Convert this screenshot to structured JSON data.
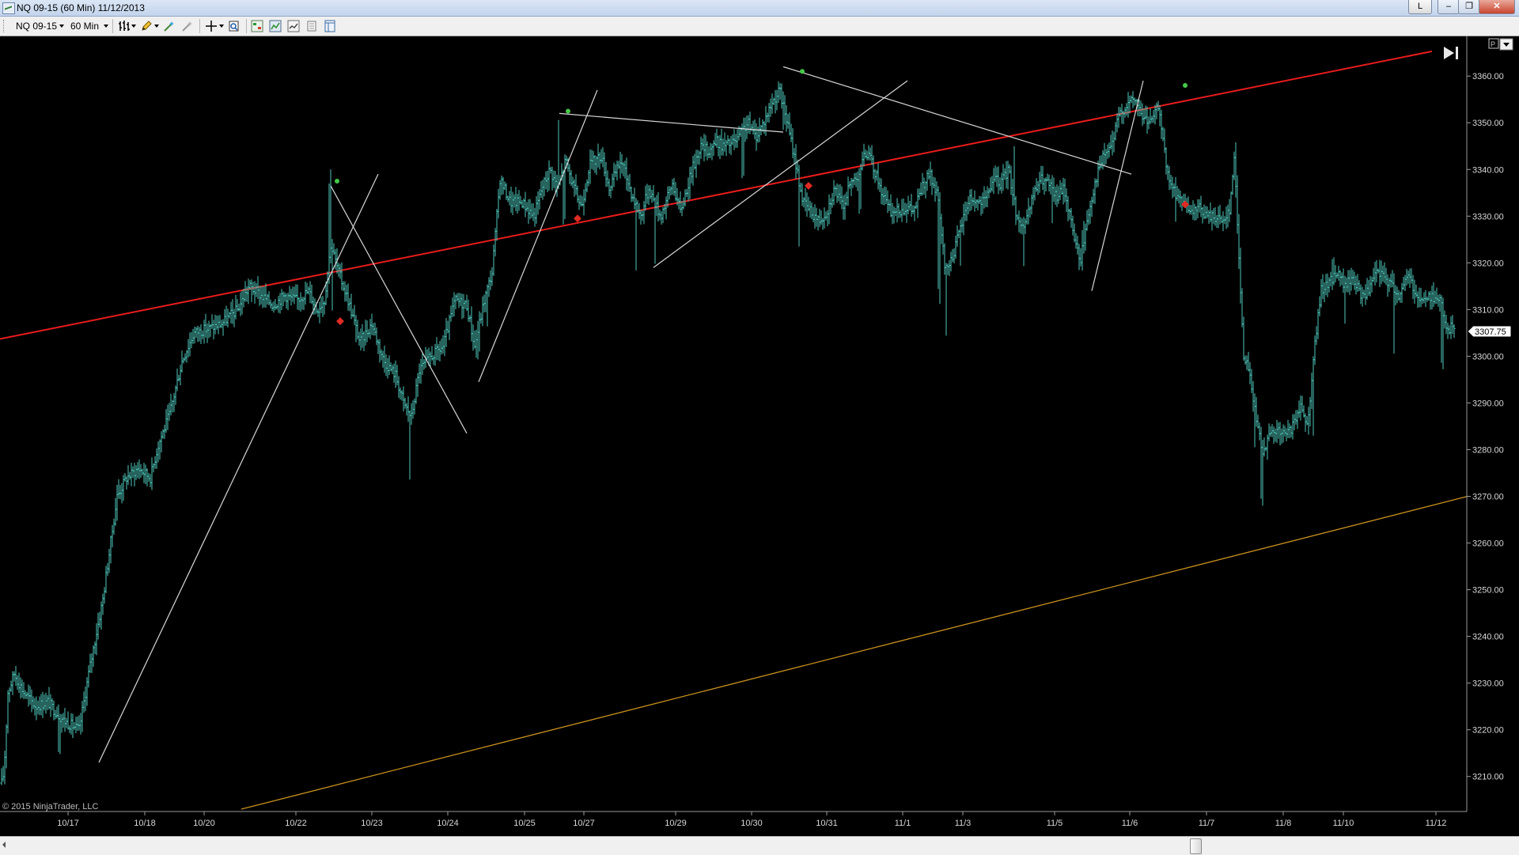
{
  "window": {
    "title": "NQ 09-15 (60 Min)  11/12/2013",
    "btn_l": "L",
    "btn_min": "–",
    "btn_max": "❐",
    "btn_close": "✕"
  },
  "toolbar": {
    "instrument": "NQ 09-15",
    "interval": "60 Min",
    "icons": [
      "bar-style-icon",
      "pencil-draw-icon",
      "magic-wand-icon",
      "wand-disabled-icon",
      "crosshair-icon",
      "zoom-icon",
      "chart-trader-icon",
      "strategies-icon",
      "indicators-icon",
      "properties-icon",
      "data-box-icon"
    ]
  },
  "chart": {
    "copyright": "© 2015 NinjaTrader, LLC",
    "price_marker": "3307.75",
    "y_ticks": [
      "3360.00",
      "3350.00",
      "3340.00",
      "3330.00",
      "3320.00",
      "3310.00",
      "3300.00",
      "3290.00",
      "3280.00",
      "3270.00",
      "3260.00",
      "3250.00",
      "3240.00",
      "3230.00",
      "3220.00",
      "3210.00"
    ],
    "x_ticks": [
      "10/17",
      "10/18",
      "10/20",
      "10/22",
      "10/23",
      "10/24",
      "10/25",
      "10/27",
      "10/29",
      "10/30",
      "10/31",
      "11/1",
      "11/3",
      "11/5",
      "11/6",
      "11/7",
      "11/8",
      "11/10",
      "11/12"
    ],
    "colors": {
      "background": "#000000",
      "bars": "#4fc9bd",
      "trendline_red": "#e81c1c",
      "trendline_gold": "#c8901e",
      "zigzag": "#d8d8d8",
      "dot_high": "#46c84a",
      "dot_low": "#e02a24"
    }
  },
  "chart_data": {
    "type": "ohlc",
    "instrument": "NQ 09-15",
    "interval": "60 Min",
    "ylim": [
      3202.5,
      3368.5
    ],
    "anchor_points": [
      [
        0,
        3207
      ],
      [
        5,
        3211
      ],
      [
        10,
        3228
      ],
      [
        18,
        3232
      ],
      [
        30,
        3228
      ],
      [
        45,
        3225
      ],
      [
        60,
        3226
      ],
      [
        80,
        3222
      ],
      [
        100,
        3220
      ],
      [
        112,
        3232
      ],
      [
        130,
        3248
      ],
      [
        148,
        3270
      ],
      [
        160,
        3274
      ],
      [
        175,
        3276
      ],
      [
        190,
        3274
      ],
      [
        200,
        3281
      ],
      [
        215,
        3288
      ],
      [
        230,
        3299
      ],
      [
        245,
        3305
      ],
      [
        265,
        3306
      ],
      [
        280,
        3307
      ],
      [
        300,
        3310
      ],
      [
        315,
        3315
      ],
      [
        330,
        3313
      ],
      [
        345,
        3311
      ],
      [
        360,
        3313
      ],
      [
        375,
        3312
      ],
      [
        390,
        3314
      ],
      [
        400,
        3310
      ],
      [
        410,
        3312
      ],
      [
        418,
        3324
      ],
      [
        428,
        3318
      ],
      [
        440,
        3312
      ],
      [
        455,
        3303
      ],
      [
        470,
        3307
      ],
      [
        485,
        3299
      ],
      [
        500,
        3296
      ],
      [
        510,
        3290
      ],
      [
        520,
        3287
      ],
      [
        530,
        3297
      ],
      [
        545,
        3300
      ],
      [
        560,
        3302
      ],
      [
        575,
        3312
      ],
      [
        590,
        3311
      ],
      [
        600,
        3302
      ],
      [
        612,
        3312
      ],
      [
        622,
        3318
      ],
      [
        632,
        3338
      ],
      [
        645,
        3333
      ],
      [
        660,
        3333
      ],
      [
        675,
        3330
      ],
      [
        685,
        3336
      ],
      [
        695,
        3340
      ],
      [
        705,
        3336
      ],
      [
        715,
        3342
      ],
      [
        725,
        3336
      ],
      [
        735,
        3332
      ],
      [
        745,
        3341
      ],
      [
        760,
        3343
      ],
      [
        770,
        3336
      ],
      [
        785,
        3342
      ],
      [
        800,
        3334
      ],
      [
        810,
        3330
      ],
      [
        820,
        3336
      ],
      [
        835,
        3330
      ],
      [
        850,
        3337
      ],
      [
        860,
        3331
      ],
      [
        875,
        3340
      ],
      [
        885,
        3345
      ],
      [
        895,
        3344
      ],
      [
        905,
        3346
      ],
      [
        915,
        3345
      ],
      [
        930,
        3346
      ],
      [
        945,
        3350
      ],
      [
        955,
        3347
      ],
      [
        965,
        3350
      ],
      [
        975,
        3354
      ],
      [
        985,
        3357
      ],
      [
        995,
        3350
      ],
      [
        1005,
        3342
      ],
      [
        1015,
        3333
      ],
      [
        1025,
        3331
      ],
      [
        1035,
        3329
      ],
      [
        1045,
        3331
      ],
      [
        1055,
        3336
      ],
      [
        1065,
        3332
      ],
      [
        1075,
        3337
      ],
      [
        1085,
        3339
      ],
      [
        1095,
        3344
      ],
      [
        1105,
        3340
      ],
      [
        1115,
        3335
      ],
      [
        1125,
        3331
      ],
      [
        1135,
        3331
      ],
      [
        1145,
        3332
      ],
      [
        1155,
        3331
      ],
      [
        1165,
        3336
      ],
      [
        1175,
        3339
      ],
      [
        1185,
        3334
      ],
      [
        1195,
        3318
      ],
      [
        1205,
        3322
      ],
      [
        1215,
        3328
      ],
      [
        1225,
        3334
      ],
      [
        1235,
        3333
      ],
      [
        1245,
        3333
      ],
      [
        1255,
        3338
      ],
      [
        1265,
        3337
      ],
      [
        1275,
        3340
      ],
      [
        1285,
        3330
      ],
      [
        1295,
        3327
      ],
      [
        1305,
        3334
      ],
      [
        1315,
        3338
      ],
      [
        1325,
        3337
      ],
      [
        1335,
        3334
      ],
      [
        1345,
        3336
      ],
      [
        1355,
        3328
      ],
      [
        1365,
        3320
      ],
      [
        1375,
        3330
      ],
      [
        1385,
        3338
      ],
      [
        1395,
        3343
      ],
      [
        1405,
        3345
      ],
      [
        1415,
        3352
      ],
      [
        1425,
        3354
      ],
      [
        1435,
        3355
      ],
      [
        1445,
        3351
      ],
      [
        1455,
        3350
      ],
      [
        1465,
        3354
      ],
      [
        1475,
        3339
      ],
      [
        1485,
        3335
      ],
      [
        1495,
        3333
      ],
      [
        1505,
        3330
      ],
      [
        1515,
        3332
      ],
      [
        1525,
        3330
      ],
      [
        1535,
        3330
      ],
      [
        1545,
        3329
      ],
      [
        1555,
        3332
      ],
      [
        1560,
        3343
      ],
      [
        1565,
        3325
      ],
      [
        1572,
        3300
      ],
      [
        1580,
        3296
      ],
      [
        1588,
        3286
      ],
      [
        1596,
        3280
      ],
      [
        1605,
        3283
      ],
      [
        1615,
        3284
      ],
      [
        1625,
        3283
      ],
      [
        1635,
        3285
      ],
      [
        1645,
        3290
      ],
      [
        1653,
        3285
      ],
      [
        1660,
        3300
      ],
      [
        1670,
        3314
      ],
      [
        1680,
        3316
      ],
      [
        1690,
        3318
      ],
      [
        1700,
        3315
      ],
      [
        1710,
        3317
      ],
      [
        1720,
        3313
      ],
      [
        1730,
        3314
      ],
      [
        1740,
        3318
      ],
      [
        1750,
        3317
      ],
      [
        1760,
        3315
      ],
      [
        1770,
        3313
      ],
      [
        1780,
        3318
      ],
      [
        1790,
        3313
      ],
      [
        1800,
        3312
      ],
      [
        1810,
        3313
      ],
      [
        1820,
        3312
      ],
      [
        1830,
        3305
      ],
      [
        1838,
        3307
      ]
    ],
    "spikes": [
      [
        26,
        -2
      ],
      [
        40,
        -2
      ],
      [
        75,
        -8
      ],
      [
        108,
        -4
      ],
      [
        150,
        3
      ],
      [
        175,
        -2
      ],
      [
        318,
        -3
      ],
      [
        417,
        16
      ],
      [
        420,
        -13
      ],
      [
        450,
        -3
      ],
      [
        518,
        -14
      ],
      [
        605,
        -6
      ],
      [
        616,
        -8
      ],
      [
        706,
        14
      ],
      [
        713,
        -12
      ],
      [
        804,
        -14
      ],
      [
        828,
        -13
      ],
      [
        939,
        -10
      ],
      [
        990,
        -5
      ],
      [
        1010,
        -14
      ],
      [
        1087,
        -9
      ],
      [
        1102,
        4
      ],
      [
        1187,
        -18
      ],
      [
        1196,
        -14
      ],
      [
        1214,
        -8
      ],
      [
        1282,
        12
      ],
      [
        1294,
        -8
      ],
      [
        1330,
        -7
      ],
      [
        1369,
        4
      ],
      [
        1449,
        3
      ],
      [
        1474,
        2
      ],
      [
        1486,
        -6
      ],
      [
        1536,
        -2
      ],
      [
        1562,
        10
      ],
      [
        1586,
        -8
      ],
      [
        1595,
        -12
      ],
      [
        1660,
        -17
      ],
      [
        1685,
        4
      ],
      [
        1700,
        -8
      ],
      [
        1762,
        -14
      ],
      [
        1823,
        -12
      ]
    ],
    "trendlines": [
      {
        "name": "red-trendline",
        "from": [
          0,
          3303.7
        ],
        "to": [
          1810,
          3365.3
        ]
      },
      {
        "name": "gold-trendline",
        "from": [
          305,
          3203
        ],
        "to": [
          1855,
          3270
        ]
      }
    ],
    "zigzag_lines": [
      {
        "from": [
          125,
          3213
        ],
        "to": [
          478,
          3339
        ]
      },
      {
        "from": [
          418,
          3336.5
        ],
        "to": [
          590,
          3283.5
        ]
      },
      {
        "from": [
          605,
          3294.5
        ],
        "to": [
          755,
          3357
        ]
      },
      {
        "from": [
          707,
          3352
        ],
        "to": [
          990,
          3348
        ]
      },
      {
        "from": [
          826,
          3319
        ],
        "to": [
          1147,
          3359
        ]
      },
      {
        "from": [
          990,
          3362
        ],
        "to": [
          1430,
          3339
        ]
      },
      {
        "from": [
          1380,
          3314
        ],
        "to": [
          1445,
          3359
        ]
      }
    ],
    "swing_highs": [
      [
        426,
        3337.5
      ],
      [
        718,
        3352.5
      ],
      [
        1014,
        3361
      ],
      [
        1498,
        3358
      ]
    ],
    "swing_lows": [
      [
        430,
        3307.5
      ],
      [
        730,
        3329.5
      ],
      [
        1022,
        3336.5
      ],
      [
        1498,
        3332.5
      ]
    ]
  }
}
